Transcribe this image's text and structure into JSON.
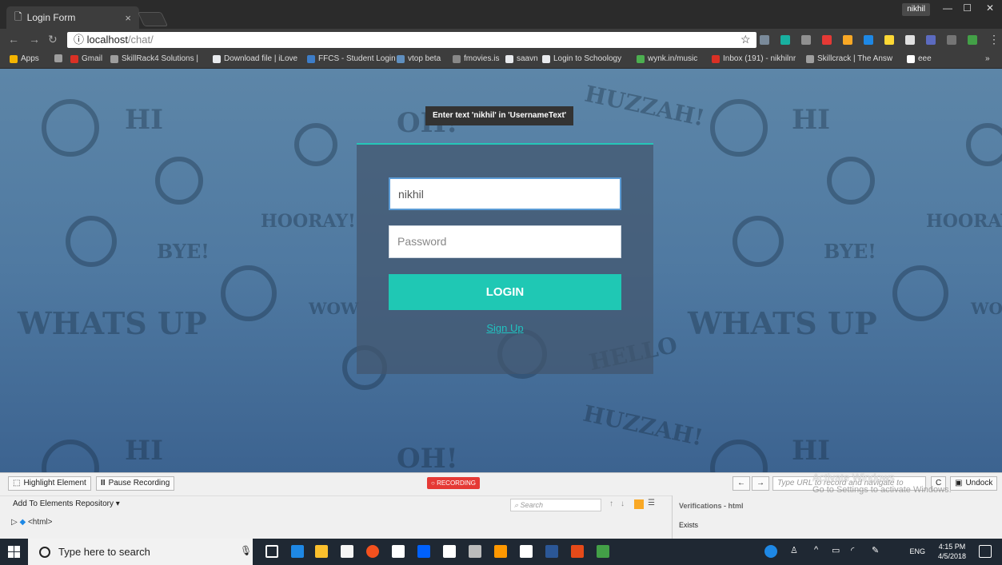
{
  "browser": {
    "tab_title": "Login Form",
    "tab_close": "×",
    "profile_name": "nikhil",
    "url_host": "localhost",
    "url_path": "/chat/",
    "bookmarks": [
      {
        "label": "Apps",
        "color": "#f4b400"
      },
      {
        "label": "Gmail",
        "color": "#d93025"
      },
      {
        "label": "SkillRack4 Solutions |",
        "color": "#9e9e9e"
      },
      {
        "label": "Download file | iLove",
        "color": "#e8eaed"
      },
      {
        "label": "FFCS - Student Login",
        "color": "#3d7dc8"
      },
      {
        "label": "vtop beta",
        "color": "#5f8fbf"
      },
      {
        "label": "fmovies.is",
        "color": "#888888"
      },
      {
        "label": "saavn",
        "color": "#e8eaed"
      },
      {
        "label": "Login to Schoology",
        "color": "#e8eaed"
      },
      {
        "label": "wynk.in/music",
        "color": "#4caf50"
      },
      {
        "label": "Inbox (191) - nikhilnr",
        "color": "#d93025"
      },
      {
        "label": "Skillcrack | The Answ",
        "color": "#9e9e9e"
      },
      {
        "label": "eee",
        "color": "#ffffff"
      }
    ],
    "more": "»"
  },
  "page": {
    "tooltip": "Enter text 'nikhil' in 'UsernameText'",
    "username_value": "nikhil",
    "password_placeholder": "Password",
    "login_label": "LOGIN",
    "signup_label": "Sign Up",
    "deco_words": [
      "HUZZAH!",
      "OH!",
      "HOORAY!",
      "BYE!",
      "WOW",
      "WHATS UP",
      "HELLO",
      "HOORAY!",
      "BYE!",
      "WHATS UP",
      "HUZZAH!",
      "OH!",
      "WO"
    ]
  },
  "recorder": {
    "highlight_label": "Highlight Element",
    "pause_label": "Pause Recording",
    "recording_badge": "RECORDING",
    "url_placeholder": "Type URL to record and navigate to",
    "undock_label": "Undock",
    "add_repo_label": "Add To Elements Repository ▾",
    "search_placeholder": "Search",
    "html_node": "<html>",
    "verifications_title": "Verifications - html",
    "exists_label": "Exists",
    "activate_title": "Activate Windows",
    "activate_sub": "Go to Settings to activate Windows."
  },
  "taskbar": {
    "search_placeholder": "Type here to search",
    "lang": "ENG",
    "time": "4:15 PM",
    "date": "4/5/2018"
  }
}
